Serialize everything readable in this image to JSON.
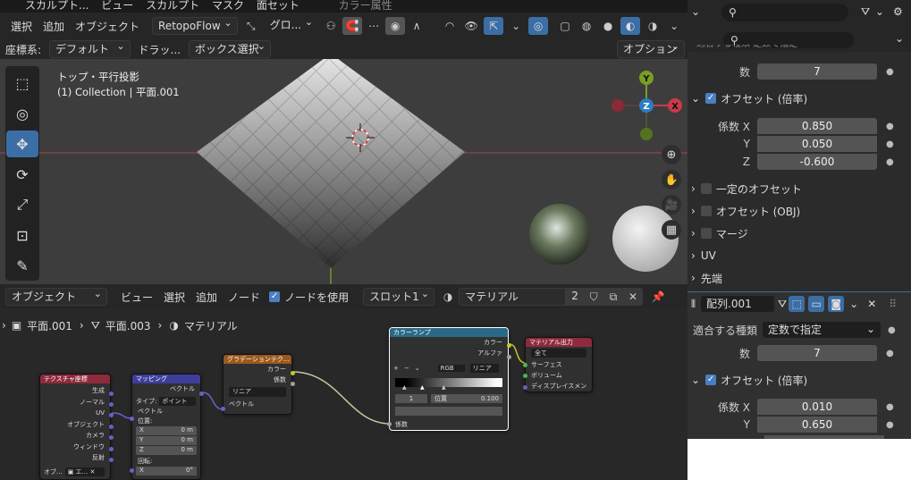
{
  "top_menu": {
    "sculpt_tab": "スカルプト...",
    "view": "ビュー",
    "sculpt": "スカルプト",
    "mask": "マスク",
    "face_set": "面セット",
    "color_attr": "カラー属性"
  },
  "viewport_header": {
    "select": "選択",
    "add": "追加",
    "object": "オブジェクト",
    "retopoflow": "RetopoFlow",
    "transform_orientation": "グロ...",
    "coord_label": "座標系:",
    "coord_value": "デフォルト",
    "drag_label": "ドラッ...",
    "drag_value": "ボックス選択",
    "options": "オプション"
  },
  "viewport": {
    "view_name": "トップ・平行投影",
    "collection_info": "(1) Collection | 平面.001"
  },
  "gizmo": {
    "x": "X",
    "y": "Y",
    "z": "Z"
  },
  "node_editor_header": {
    "mode": "オブジェクト",
    "view": "ビュー",
    "select": "選択",
    "add": "追加",
    "node": "ノード",
    "use_nodes": "ノードを使用",
    "slot": "スロット1",
    "material": "マテリアル",
    "users": "2"
  },
  "breadcrumb": {
    "object": "平面.001",
    "mesh": "平面.003",
    "material": "マテリアル"
  },
  "nodes": {
    "texcoord": {
      "title": "テクスチャ座標",
      "outputs": [
        "生成",
        "ノーマル",
        "UV",
        "オブジェクト",
        "カメラ",
        "ウィンドウ",
        "反射"
      ],
      "obj_label": "オブ...",
      "obj_value": "エ..."
    },
    "mapping": {
      "title": "マッピング",
      "out": "ベクトル",
      "type_label": "タイプ:",
      "type_value": "ポイント",
      "in_vector": "ベクトル",
      "location": "位置:",
      "x": "X",
      "y": "Y",
      "z": "Z",
      "x_val": "0 m",
      "y_val": "0 m",
      "z_val": "0 m",
      "rotation": "回転:",
      "rx": "X",
      "rx_val": "0°"
    },
    "gradient": {
      "title": "グラデーションテク...",
      "color": "カラー",
      "fac": "係数",
      "type": "リニア",
      "vector": "ベクトル"
    },
    "colorramp": {
      "title": "カラーランプ",
      "color": "カラー",
      "alpha": "アルファ",
      "plus": "+",
      "minus": "−",
      "mode": "RGB",
      "interp": "リニア",
      "index": "1",
      "pos_label": "位置",
      "pos_value": "0.100",
      "fac": "係数"
    },
    "output": {
      "title": "マテリアル出力",
      "target": "全て",
      "surface": "サーフェス",
      "volume": "ボリューム",
      "displacement": "ディスプレイスメント"
    }
  },
  "properties": {
    "fit_type_top": "適合する種類  定数で指定",
    "count_label": "数",
    "count_value": "7",
    "offset_relative": "オフセット (倍率)",
    "factor_x_label": "係数 X",
    "factor_x": "0.850",
    "y_label": "Y",
    "factor_y": "0.050",
    "z_label": "Z",
    "factor_z": "-0.600",
    "const_offset": "一定のオフセット",
    "obj_offset": "オフセット (OBJ)",
    "merge": "マージ",
    "uv": "UV",
    "caps": "先端",
    "modifier_name": "配列.001",
    "fit_type_label": "適合する種類",
    "fit_type_value": "定数で指定",
    "count2_label": "数",
    "count2_value": "7",
    "offset_relative2": "オフセット (倍率)",
    "factor_x2_label": "係数 X",
    "factor_x2": "0.010",
    "y2_label": "Y",
    "factor_y2": "0.650"
  },
  "colors": {
    "accent": "#3b6ea5",
    "axis_x": "#c93a4a",
    "axis_y": "#7a9e22",
    "axis_z": "#2a7ec4"
  }
}
